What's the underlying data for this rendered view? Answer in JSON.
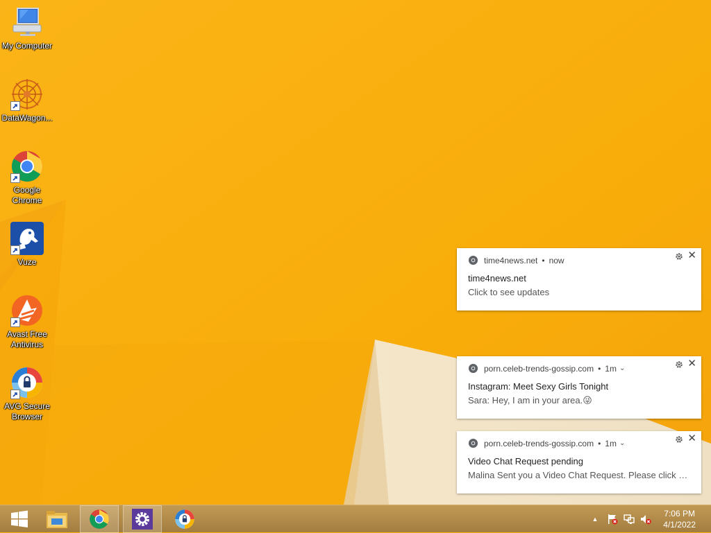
{
  "desktop": {
    "icons": [
      {
        "label": "My Computer"
      },
      {
        "label": "DataWagon..."
      },
      {
        "label": "Google Chrome"
      },
      {
        "label": "Vuze"
      },
      {
        "label": "Avast Free Antivirus"
      },
      {
        "label": "AVG Secure Browser"
      }
    ]
  },
  "notifications": [
    {
      "site": "time4news.net",
      "time": "now",
      "title": "time4news.net",
      "body": "Click to see updates",
      "has_chevron": false
    },
    {
      "site": "porn.celeb-trends-gossip.com",
      "time": "1m",
      "title": "Instagram: Meet Sexy Girls Tonight",
      "body": "Sara: Hey, I am in your area.😜",
      "has_chevron": true
    },
    {
      "site": "porn.celeb-trends-gossip.com",
      "time": "1m",
      "title": "Video Chat Request pending",
      "body": "Malina Sent you a Video Chat Request. Please click an...",
      "has_chevron": true
    }
  ],
  "notification_glyphs": {
    "dot": "•",
    "close": "✕",
    "chevron": "⌄"
  },
  "taskbar": {
    "clock_time": "7:06 PM",
    "clock_date": "4/1/2022",
    "tray_expand": "▲"
  },
  "colors": {
    "wallpaper": "#f9b20c",
    "taskbar": "#b0894a"
  }
}
